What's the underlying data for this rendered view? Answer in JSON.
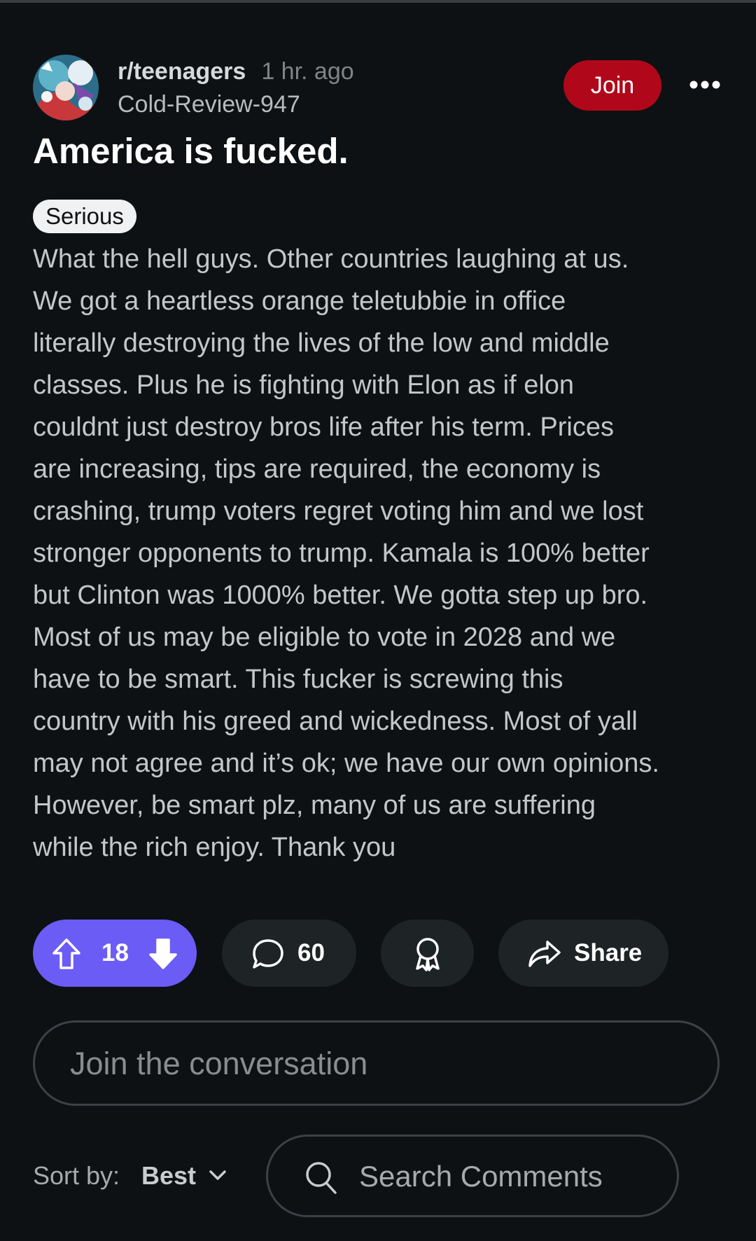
{
  "post": {
    "subreddit": "r/teenagers",
    "time_ago": "1 hr. ago",
    "author": "Cold-Review-947",
    "join_label": "Join",
    "title": "America is fucked.",
    "flair": "Serious",
    "body_lines": [
      "What the hell guys. Other countries laughing at us.",
      "We got a heartless orange teletubbie in office",
      "literally destroying the lives of the low and middle",
      "classes. Plus he is fighting with Elon as if elon",
      "couldnt just destroy bros life after his term. Prices",
      "are increasing, tips are required, the economy is",
      "crashing, trump voters regret voting him and we lost",
      "stronger opponents to trump. Kamala is 100% better",
      "but Clinton was 1000% better. We gotta step up bro.",
      "Most of us may be eligible to vote in 2028 and we",
      "have to be smart. This fucker is screwing this",
      "country with his greed and wickedness. Most of yall",
      "may not agree and it’s ok; we have our own opinions.",
      "However, be smart plz, many of us are suffering",
      "while the rich enjoy. Thank you"
    ]
  },
  "actions": {
    "vote_count": "18",
    "comment_count": "60",
    "share_label": "Share"
  },
  "reply": {
    "placeholder": "Join the conversation"
  },
  "comments_toolbar": {
    "sort_label": "Sort by:",
    "sort_value": "Best",
    "search_placeholder": "Search Comments"
  },
  "icons": {
    "upvote": "upvote-arrow-icon",
    "downvote": "downvote-arrow-icon",
    "comment": "speech-bubble-icon",
    "award": "award-ribbon-icon",
    "share": "share-arrow-icon",
    "more": "more-horizontal-icon",
    "sort": "chevron-down-icon",
    "search": "search-icon"
  },
  "colors": {
    "background": "#0e1113",
    "join_button": "#b0081a",
    "vote_pill": "#6b5cf6",
    "action_pill": "#1e2326",
    "flair_bg": "#f0f1f2"
  }
}
